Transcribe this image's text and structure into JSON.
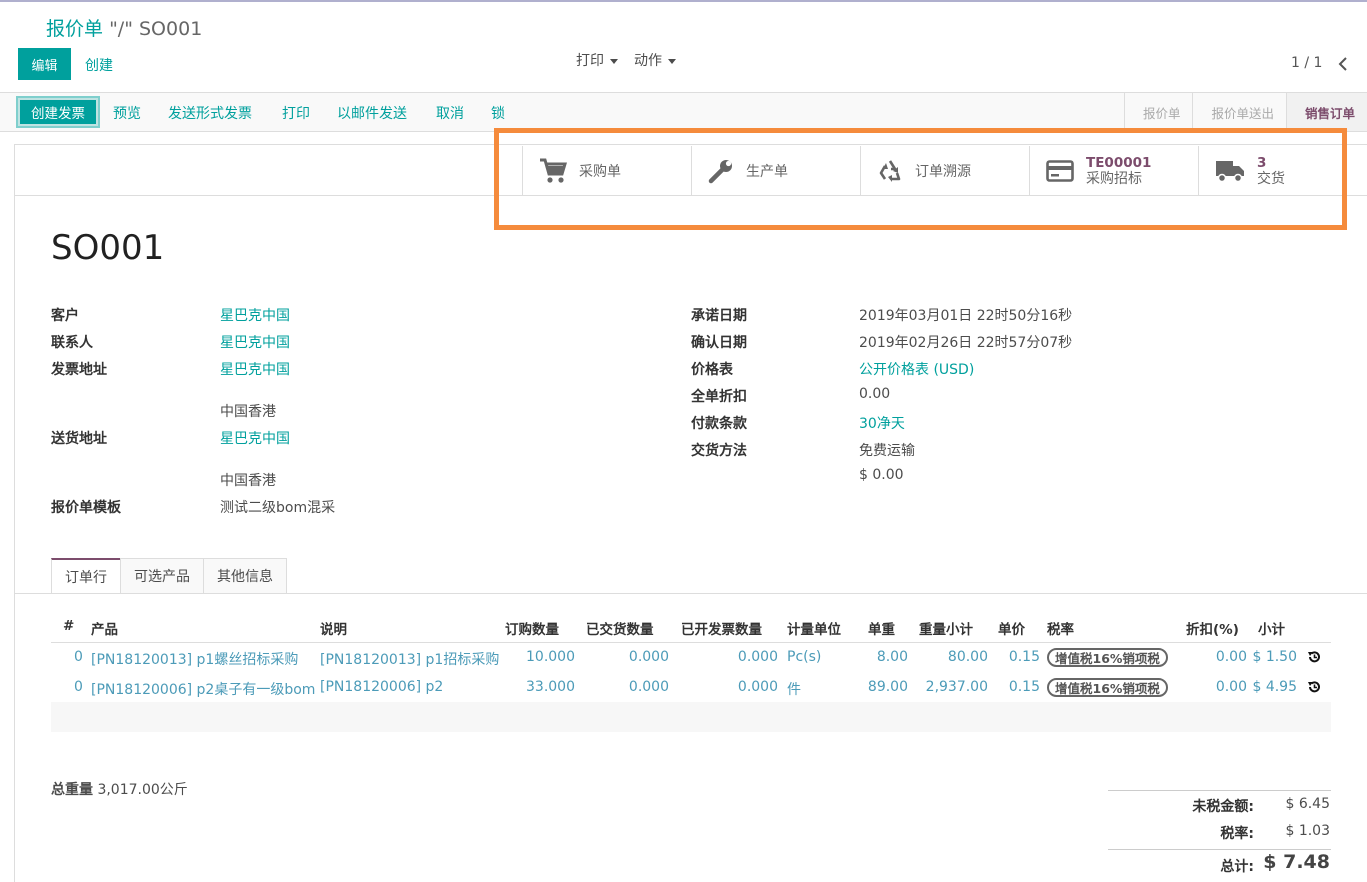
{
  "breadcrumb": {
    "parent": "报价单",
    "separator": "\"/\"",
    "current": "SO001"
  },
  "control": {
    "edit_label": "编辑",
    "create_label": "创建",
    "print_label": "打印",
    "action_label": "动作",
    "pager": "1 / 1"
  },
  "statusbar": {
    "create_invoice": "创建发票",
    "links": [
      "预览",
      "发送形式发票",
      "打印",
      "以邮件发送",
      "取消",
      "锁"
    ],
    "stages": [
      "报价单",
      "报价单送出",
      "销售订单"
    ]
  },
  "buttonbox": {
    "purchase": "采购单",
    "production": "生产单",
    "traceability": "订单溯源",
    "tender_value": "TE00001",
    "tender_label": "采购招标",
    "delivery_value": "3",
    "delivery_label": "交货"
  },
  "form": {
    "title": "SO001",
    "left": {
      "customer_label": "客户",
      "customer": "星巴克中国",
      "contact_label": "联系人",
      "contact": "星巴克中国",
      "invoice_addr_label": "发票地址",
      "invoice_addr": "星巴克中国",
      "invoice_addr_line": "中国香港",
      "delivery_addr_label": "送货地址",
      "delivery_addr": "星巴克中国",
      "delivery_addr_line": "中国香港",
      "template_label": "报价单模板",
      "template": "测试二级bom混采"
    },
    "right": {
      "commitment_label": "承诺日期",
      "commitment": "2019年03月01日 22时50分16秒",
      "confirm_label": "确认日期",
      "confirm": "2019年02月26日 22时57分07秒",
      "pricelist_label": "价格表",
      "pricelist": "公开价格表 (USD)",
      "discount_label": "全单折扣",
      "discount": "0.00",
      "terms_label": "付款条款",
      "terms": "30净天",
      "delivery_method_label": "交货方法",
      "delivery_method": "免费运输",
      "delivery_price": "$ 0.00"
    }
  },
  "tabs": [
    "订单行",
    "可选产品",
    "其他信息"
  ],
  "order_lines": {
    "headers": [
      "#",
      "产品",
      "说明",
      "订购数量",
      "已交货数量",
      "已开发票数量",
      "计量单位",
      "单重",
      "重量小计",
      "单价",
      "税率",
      "折扣(%)",
      "小计"
    ],
    "rows": [
      {
        "seq": "0",
        "product": "[PN18120013] p1螺丝招标采购",
        "desc": "[PN18120013] p1招标采购",
        "qty": "10.000",
        "delivered": "0.000",
        "invoiced": "0.000",
        "uom": "Pc(s)",
        "weight": "8.00",
        "weight_sub": "80.00",
        "price": "0.15",
        "tax": "增值税16%销项税",
        "disc": "0.00",
        "subtotal": "$ 1.50"
      },
      {
        "seq": "0",
        "product": "[PN18120006] p2桌子有一级bom",
        "desc": "[PN18120006] p2",
        "qty": "33.000",
        "delivered": "0.000",
        "invoiced": "0.000",
        "uom": "件",
        "weight": "89.00",
        "weight_sub": "2,937.00",
        "price": "0.15",
        "tax": "增值税16%销项税",
        "disc": "0.00",
        "subtotal": "$ 4.95"
      }
    ]
  },
  "footer": {
    "total_weight_label": "总重量",
    "total_weight": "3,017.00公斤",
    "untaxed_label": "未税金额:",
    "untaxed": "$ 6.45",
    "tax_label": "税率:",
    "tax": "$ 1.03",
    "total_label": "总计:",
    "total": "$ 7.48"
  },
  "colors": {
    "accent": "#00A09D",
    "stage_active": "#7c4c6c",
    "highlight": "#F58B3C"
  },
  "icons": [
    "cart-icon",
    "wrench-icon",
    "recycle-icon",
    "credit-card-icon",
    "truck-icon",
    "history-icon",
    "chevron-left-icon"
  ]
}
